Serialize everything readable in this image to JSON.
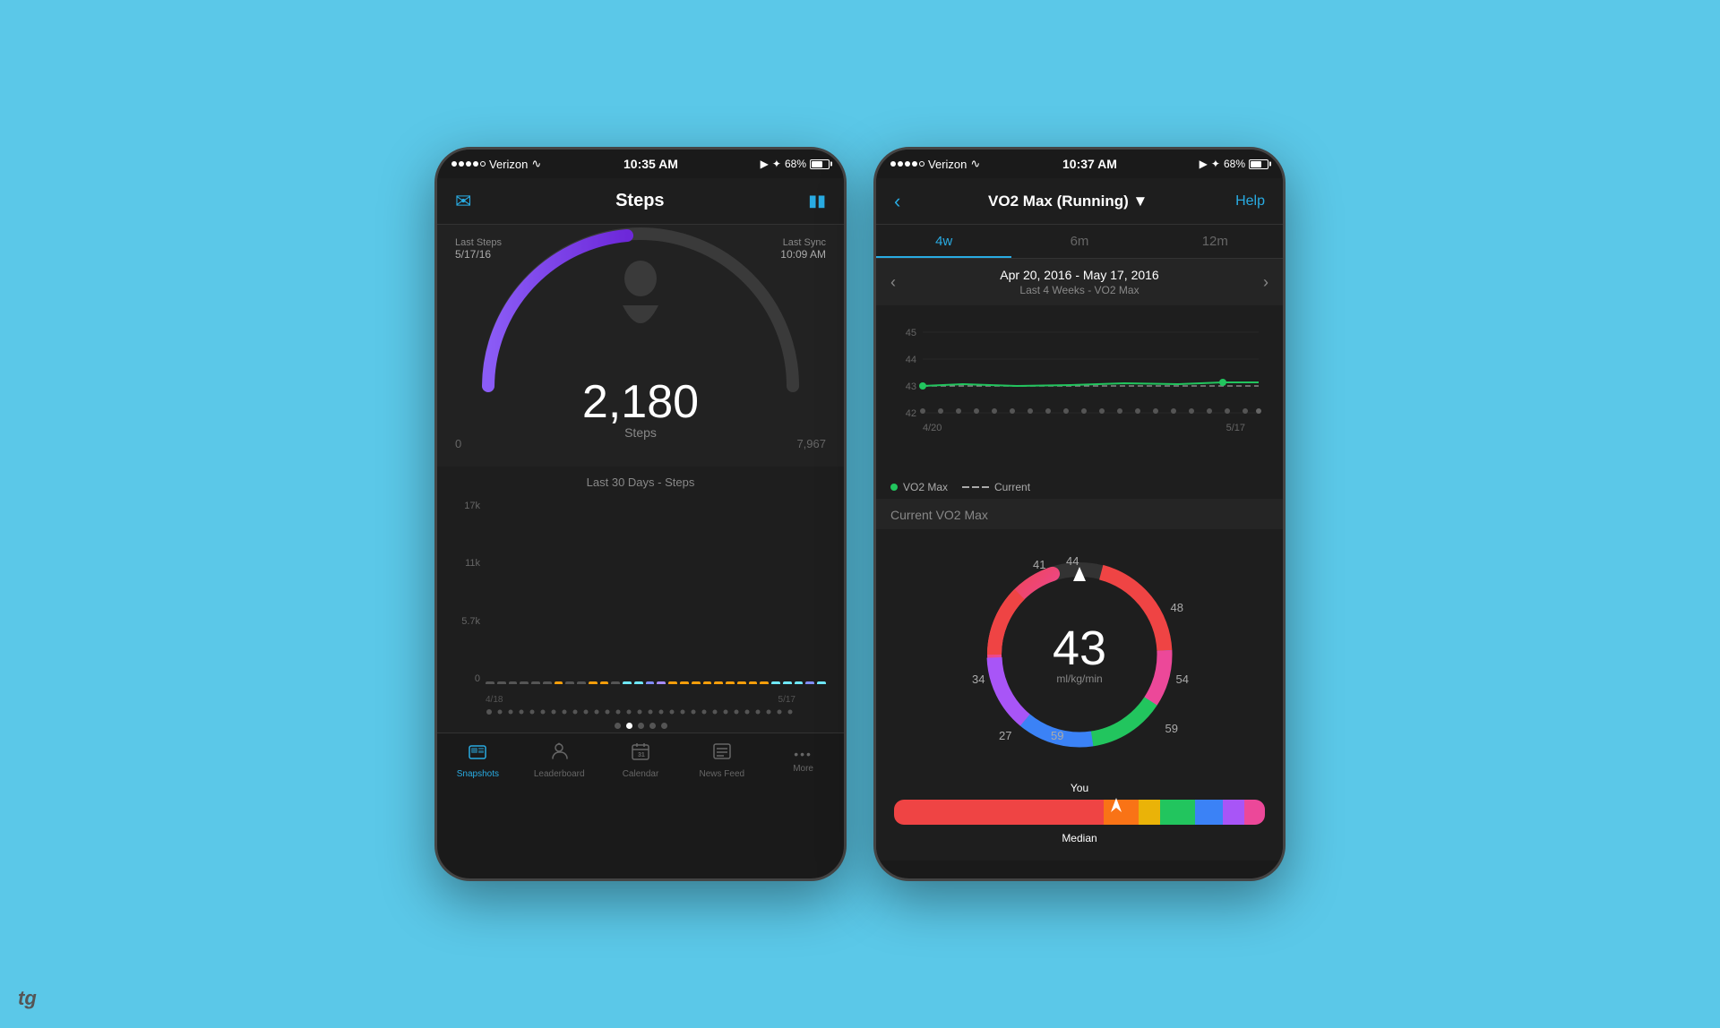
{
  "left_phone": {
    "status": {
      "carrier": "Verizon",
      "time": "10:35 AM",
      "battery": "68%"
    },
    "title": "Steps",
    "last_steps": {
      "label": "Last Steps",
      "date": "5/17/16"
    },
    "last_sync": {
      "label": "Last Sync",
      "time": "10:09 AM"
    },
    "steps_count": "2,180",
    "steps_label": "Steps",
    "range_min": "0",
    "range_max": "7,967",
    "chart_title": "Last 30 Days - Steps",
    "y_labels": [
      "17k",
      "11k",
      "5.7k",
      "0"
    ],
    "x_labels": [
      "4/18",
      "5/17"
    ],
    "nav_items": [
      {
        "label": "Snapshots",
        "icon": "📷",
        "active": true
      },
      {
        "label": "Leaderboard",
        "icon": "🏆",
        "active": false
      },
      {
        "label": "Calendar",
        "icon": "📅",
        "active": false
      },
      {
        "label": "News Feed",
        "icon": "📰",
        "active": false
      },
      {
        "label": "More",
        "icon": "•••",
        "active": false
      }
    ]
  },
  "right_phone": {
    "status": {
      "carrier": "Verizon",
      "time": "10:37 AM",
      "battery": "68%"
    },
    "title": "VO2 Max (Running) ▼",
    "help": "Help",
    "tabs": [
      {
        "label": "4w",
        "active": true
      },
      {
        "label": "6m",
        "active": false
      },
      {
        "label": "12m",
        "active": false
      }
    ],
    "date_range": "Apr 20, 2016 - May 17, 2016",
    "date_subtitle": "Last 4 Weeks - VO2 Max",
    "chart_y_labels": [
      "45",
      "44",
      "43",
      "42"
    ],
    "chart_x_labels": [
      "4/20",
      "5/17"
    ],
    "legend": {
      "vo2_label": "VO2 Max",
      "current_label": "Current"
    },
    "current_section_label": "Current VO2 Max",
    "gauge_value": "43",
    "gauge_unit": "ml/kg/min",
    "gauge_labels": {
      "top_left": "41",
      "top_center": "44",
      "right_upper": "48",
      "right": "54",
      "right_lower": "59",
      "bottom_right": "59",
      "bottom_left": "27",
      "left": "34"
    },
    "you_label": "You",
    "median_label": "Median"
  },
  "watermark": "tg"
}
